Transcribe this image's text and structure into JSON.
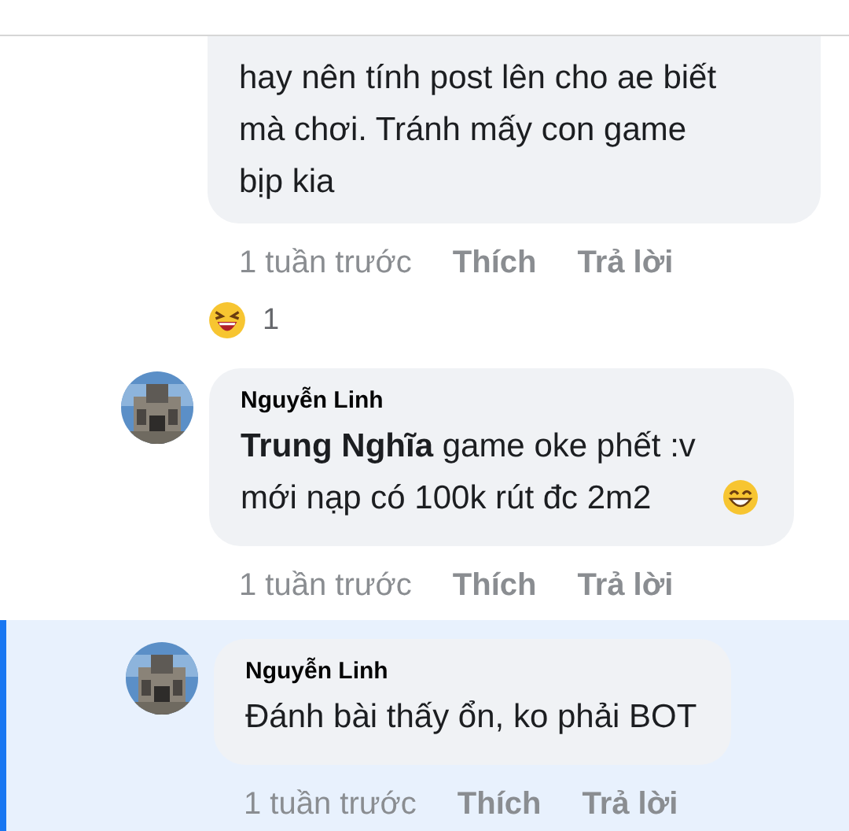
{
  "comments": [
    {
      "kind": "plain",
      "highlighted": false,
      "text": "hay nên tính post lên cho ae biết mà chơi. Tránh mấy con game bịp kia",
      "time": "1 tuần trước",
      "like": "Thích",
      "reply": "Trả lời",
      "reaction_count": "1"
    },
    {
      "kind": "with-emoji",
      "highlighted": false,
      "author": "Nguyễn Linh",
      "text": "**Trung Nghĩa** game oke phết :v mới nạp có 100k rút đc 2m2",
      "time": "1 tuần trước",
      "like": "Thích",
      "reply": "Trả lời"
    },
    {
      "kind": "plain",
      "highlighted": true,
      "author": "Nguyễn Linh",
      "text": "Đánh bài thấy ổn, ko phải BOT",
      "time": "1 tuần trước",
      "like": "Thích",
      "reply": "Trả lời"
    }
  ]
}
